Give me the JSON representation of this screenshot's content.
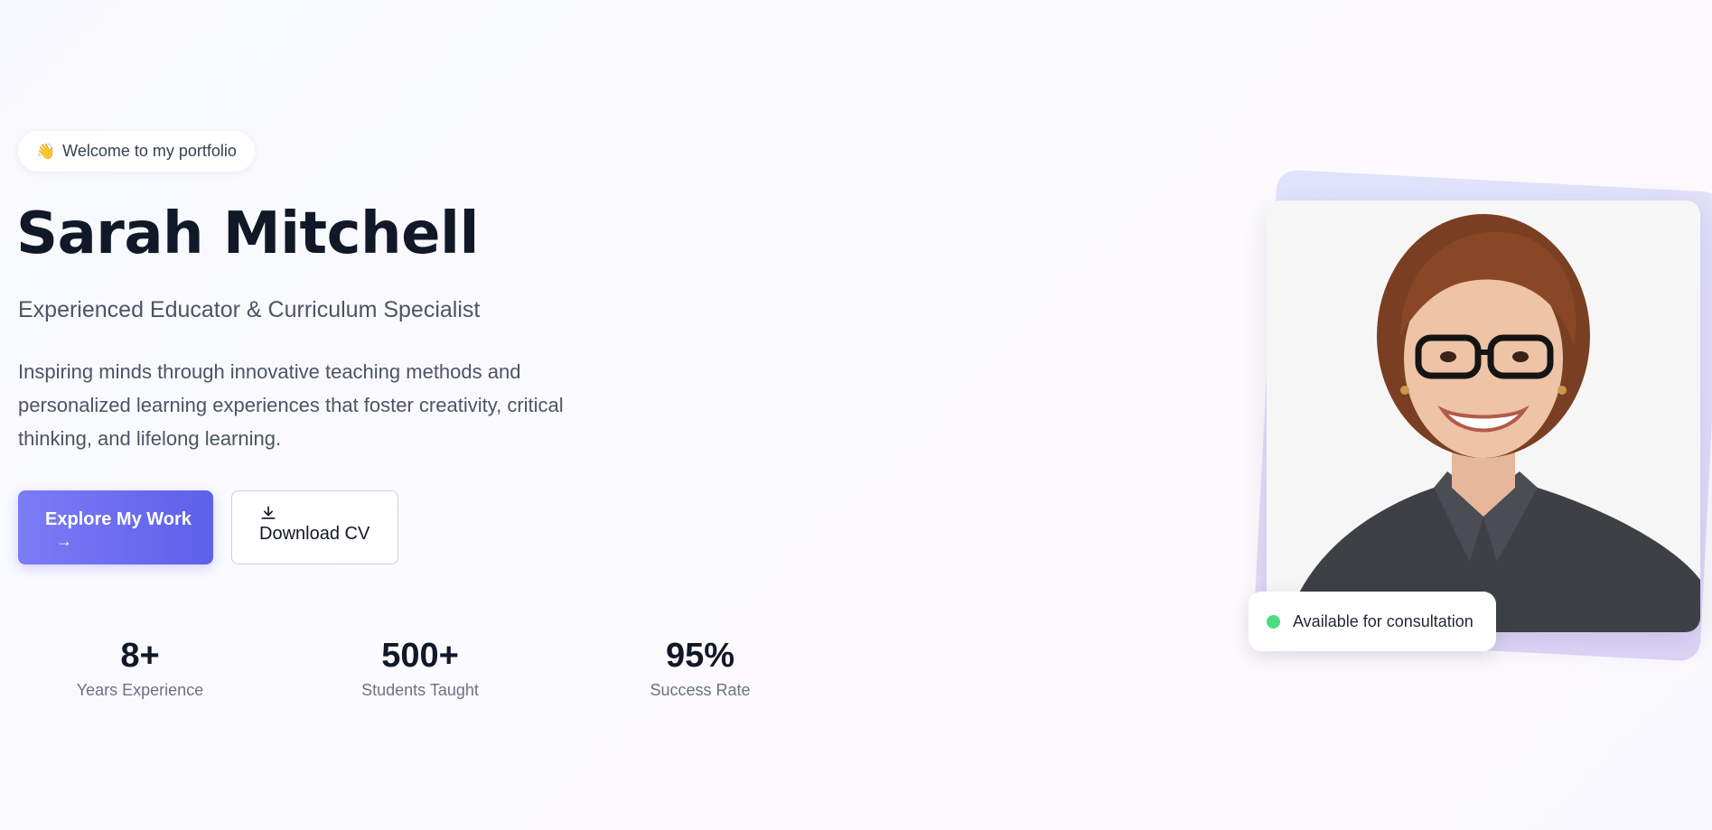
{
  "badge": {
    "emoji": "👋",
    "text": "Welcome to my portfolio"
  },
  "hero": {
    "name": "Sarah Mitchell",
    "subtitle": "Experienced Educator & Curriculum Specialist",
    "description": "Inspiring minds through innovative teaching methods and personalized learning experiences that foster creativity, critical thinking, and lifelong learning."
  },
  "buttons": {
    "primary_label": "Explore My Work",
    "primary_arrow": "→",
    "secondary_label": "Download CV",
    "secondary_icon": "download-icon"
  },
  "stats": [
    {
      "value": "8+",
      "label": "Years Experience"
    },
    {
      "value": "500+",
      "label": "Students Taught"
    },
    {
      "value": "95%",
      "label": "Success Rate"
    }
  ],
  "availability": {
    "text": "Available for consultation",
    "status_color": "#4ade80"
  },
  "colors": {
    "accent_start": "#7c7cf5",
    "accent_end": "#5d60ea",
    "heading": "#111827"
  }
}
